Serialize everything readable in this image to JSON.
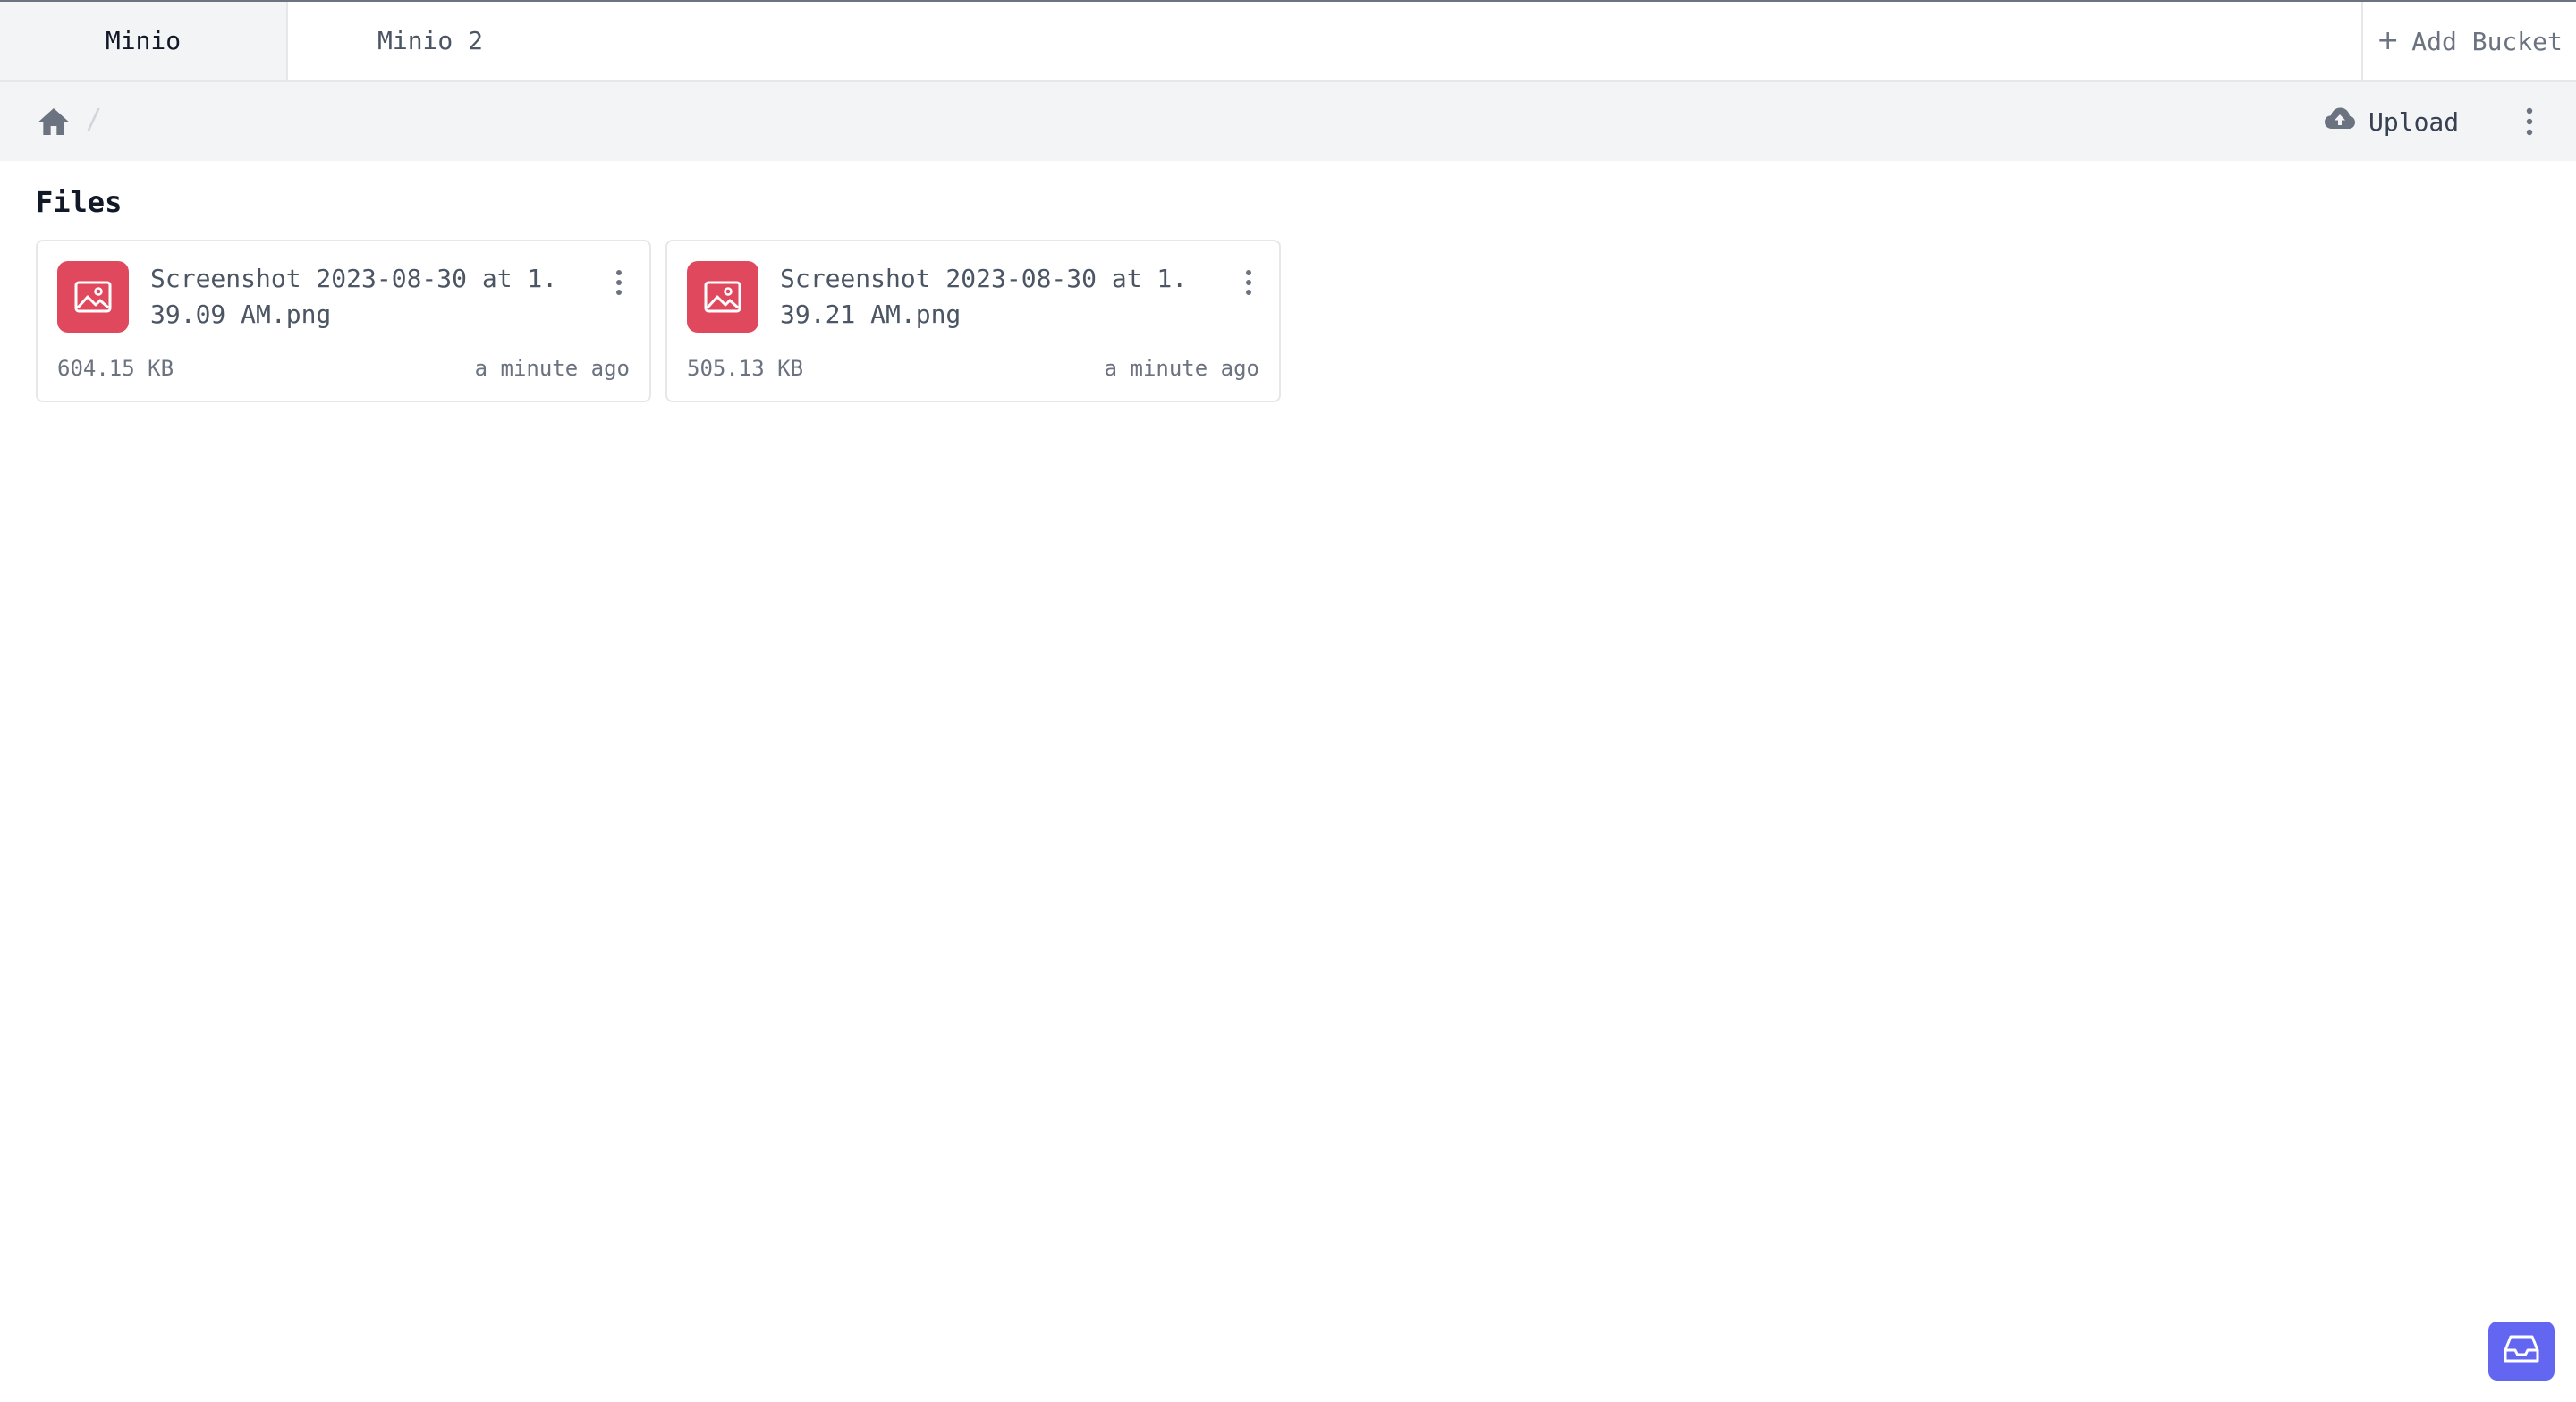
{
  "tabs": [
    {
      "label": "Minio",
      "active": true
    },
    {
      "label": "Minio 2",
      "active": false
    }
  ],
  "add_bucket_label": "Add Bucket",
  "toolbar": {
    "breadcrumb_separator": "/",
    "upload_label": "Upload"
  },
  "section_title": "Files",
  "files": [
    {
      "name": "Screenshot 2023-08-30 at 1.39.09 AM.png",
      "size": "604.15 KB",
      "modified": "a minute ago",
      "icon": "image-file-icon"
    },
    {
      "name": "Screenshot 2023-08-30 at 1.39.21 AM.png",
      "size": "505.13 KB",
      "modified": "a minute ago",
      "icon": "image-file-icon"
    }
  ],
  "colors": {
    "file_icon_bg": "#e0485e",
    "fab_bg": "#6366f1",
    "toolbar_bg": "#f3f4f6"
  }
}
